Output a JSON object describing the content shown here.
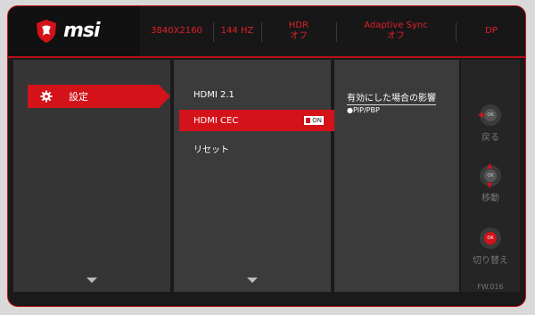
{
  "brand": {
    "logo_text": "msi",
    "accent": "#d3121a"
  },
  "header": {
    "resolution": "3840X2160",
    "refresh": "144 HZ",
    "hdr_label": "HDR",
    "hdr_value": "オフ",
    "sync_label": "Adaptive Sync",
    "sync_value": "オフ",
    "input": "DP"
  },
  "menu": {
    "main_label": "設定",
    "main_icon": "gear-icon"
  },
  "submenu": {
    "items": [
      "HDMI 2.1",
      "HDMI CEC",
      "リセット"
    ],
    "selected_index": 1,
    "toggle_label": "ON"
  },
  "description": {
    "title": "有効にした場合の影響",
    "bullet": "●PIP/PBP"
  },
  "nav": {
    "back": "戻る",
    "move": "移動",
    "switch": "切り替え",
    "ok": "OK"
  },
  "firmware": "FW.016"
}
